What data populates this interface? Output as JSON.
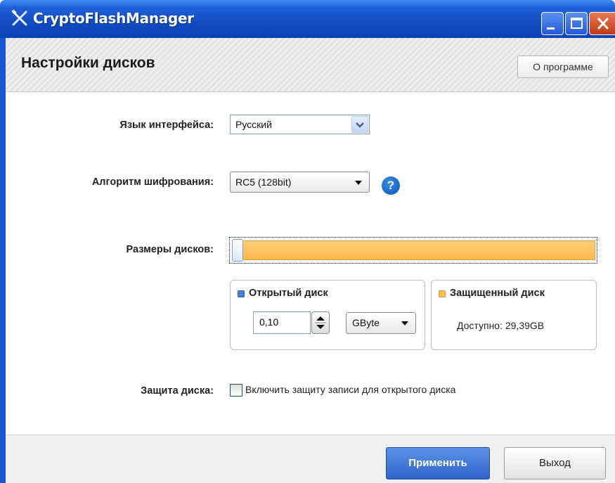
{
  "window": {
    "title": "CryptoFlashManager",
    "icons": {
      "app": "crossed-tools-icon",
      "minimize": "minimize-icon",
      "maximize": "maximize-icon",
      "close": "close-icon"
    }
  },
  "header": {
    "title": "Настройки дисков",
    "about_label": "О программе"
  },
  "form": {
    "language": {
      "label": "Язык интерфейса:",
      "value": "Русский"
    },
    "algorithm": {
      "label": "Алгоритм шифрования:",
      "value": "RC5 (128bit)",
      "help_glyph": "?"
    },
    "sizes": {
      "label": "Размеры дисков:",
      "open_fraction": 0.0034
    },
    "open_disk": {
      "title": "Открытый диск",
      "size_value": "0,10",
      "unit": "GByte"
    },
    "protected_disk": {
      "title": "Защищенный диск",
      "available_label": "Доступно:",
      "available_value": "29,39GB"
    },
    "protection": {
      "label": "Защита диска:",
      "checkbox_label": "Включить защиту записи для открытого диска",
      "checked": false
    }
  },
  "footer": {
    "apply_label": "Применить",
    "exit_label": "Выход"
  },
  "colors": {
    "titlebar": "#0f4cc2",
    "slider_fill": "#ffbf55",
    "open_disk_marker": "#4a7fd0",
    "protected_disk_marker": "#ffbf55",
    "apply_button": "#2e64c9"
  }
}
